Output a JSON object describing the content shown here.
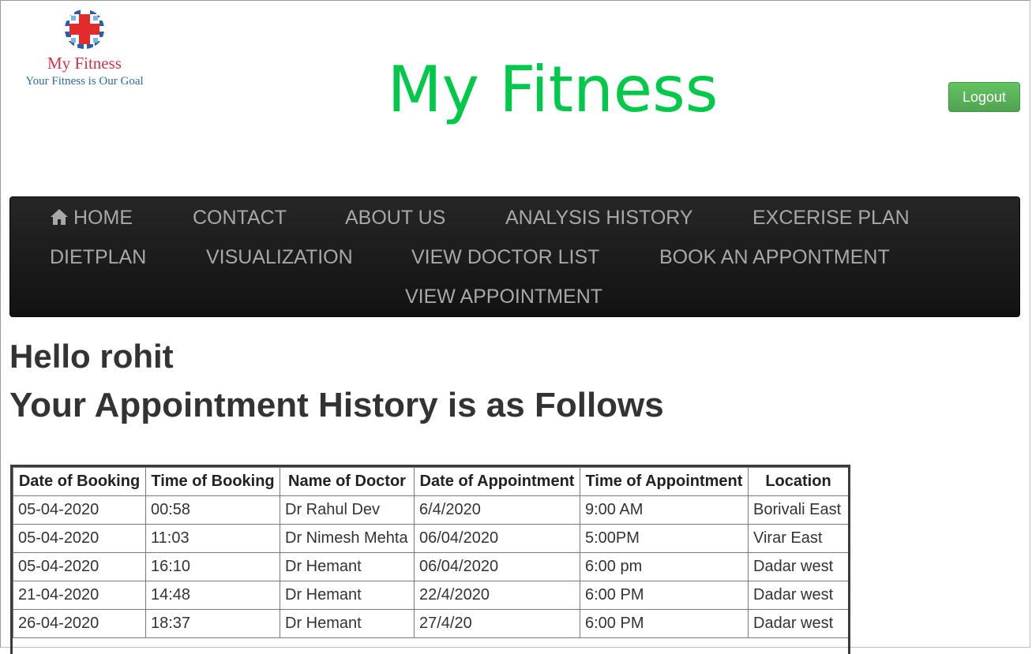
{
  "logo": {
    "title": "My Fitness",
    "tagline": "Your Fitness is Our Goal"
  },
  "header": {
    "title": "My Fitness",
    "logout_label": "Logout"
  },
  "nav": {
    "items": [
      {
        "label": "HOME",
        "icon": "home-icon"
      },
      {
        "label": "CONTACT"
      },
      {
        "label": "ABOUT US"
      },
      {
        "label": "ANALYSIS HISTORY"
      },
      {
        "label": "EXCERISE PLAN"
      },
      {
        "label": "DIETPLAN"
      },
      {
        "label": "VISUALIZATION"
      },
      {
        "label": "VIEW DOCTOR LIST"
      },
      {
        "label": "BOOK AN APPONTMENT"
      },
      {
        "label": "VIEW APPOINTMENT"
      }
    ]
  },
  "main": {
    "greeting": "Hello rohit",
    "heading": "Your Appointment History is as Follows"
  },
  "appointments": {
    "columns": [
      "Date of Booking",
      "Time of Booking",
      "Name of Doctor",
      "Date of Appointment",
      "Time of Appointment",
      "Location"
    ],
    "rows": [
      [
        "05-04-2020",
        "00:58",
        "Dr Rahul Dev",
        "6/4/2020",
        "9:00 AM",
        "Borivali East"
      ],
      [
        "05-04-2020",
        "11:03",
        "Dr Nimesh Mehta",
        "06/04/2020",
        "5:00PM",
        "Virar East"
      ],
      [
        "05-04-2020",
        "16:10",
        "Dr Hemant",
        "06/04/2020",
        "6:00 pm",
        "Dadar west"
      ],
      [
        "21-04-2020",
        "14:48",
        "Dr Hemant",
        "22/4/2020",
        "6:00 PM",
        "Dadar west"
      ],
      [
        "26-04-2020",
        "18:37",
        "Dr Hemant",
        "27/4/20",
        "6:00 PM",
        "Dadar west"
      ]
    ]
  },
  "colors": {
    "title_green": "#00c94a",
    "button_green": "#5cb85c",
    "nav_bg": "#1b1b1b",
    "nav_text": "#a8a8a8",
    "logo_red": "#d8324a",
    "logo_blue": "#2d6aa6"
  }
}
